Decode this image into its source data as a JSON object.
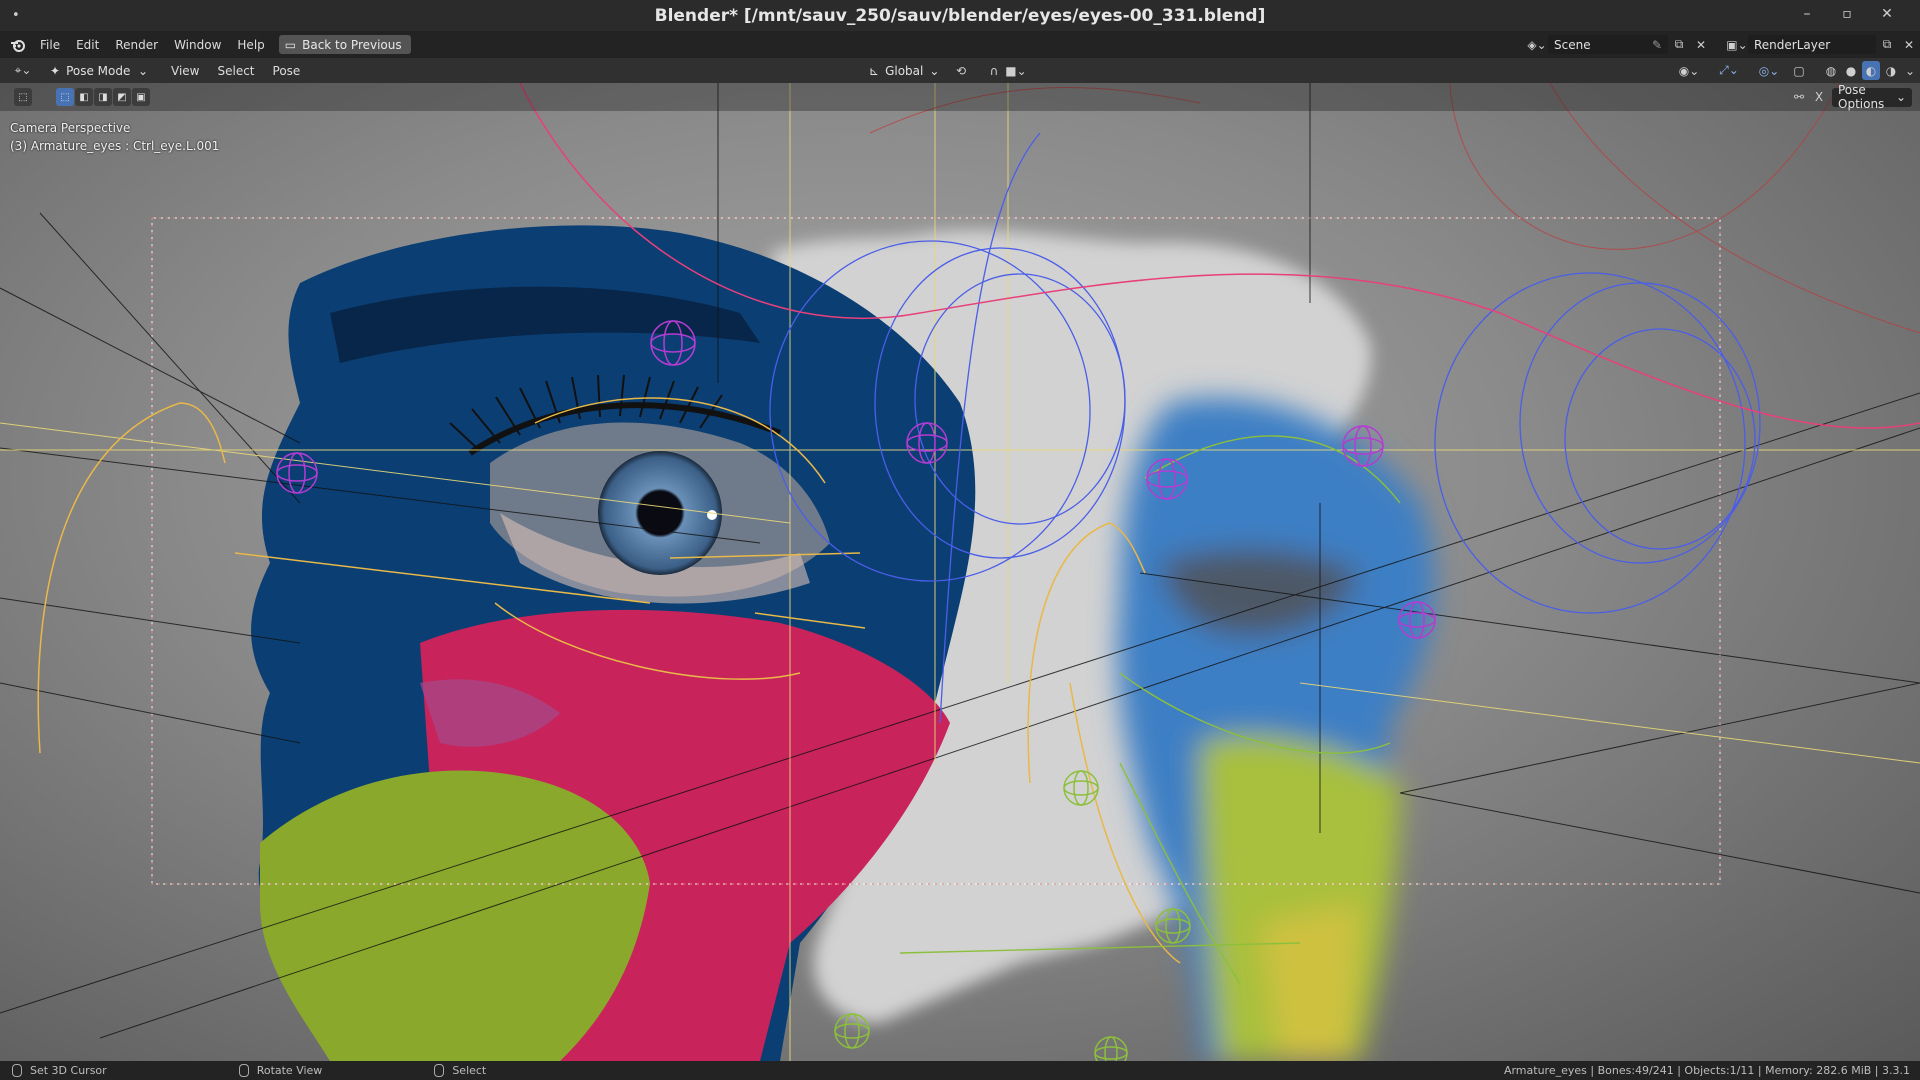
{
  "window": {
    "title": "Blender* [/mnt/sauv_250/sauv/blender/eyes/eyes-00_331.blend]",
    "controls": [
      "–",
      "▫",
      "✕"
    ]
  },
  "menubar": {
    "items": [
      "File",
      "Edit",
      "Render",
      "Window",
      "Help"
    ],
    "back_button": "Back to Previous",
    "scene": "Scene",
    "render_layer": "RenderLayer"
  },
  "header": {
    "mode": "Pose Mode",
    "menus": [
      "View",
      "Select",
      "Pose"
    ],
    "transform_orientation": "Global",
    "pose_options": "Pose Options",
    "x_label": "X"
  },
  "viewport": {
    "perspective_label": "Camera Perspective",
    "active_object": "(3) Armature_eyes : Ctrl_eye.L.001"
  },
  "statusbar": {
    "hints": [
      "Set 3D Cursor",
      "Rotate View",
      "Select"
    ],
    "stats": "Armature_eyes | Bones:49/241 | Objects:1/11 | Memory: 282.6 MiB | 3.3.1"
  },
  "colors": {
    "accent": "#4772b3",
    "bone_blue": "#4a5ee8",
    "bone_magenta": "#b43cd2",
    "bone_yellow": "#e8c050",
    "bone_green": "#8cbf3c",
    "paint_navy": "#0b3f74",
    "paint_pink": "#c8235a",
    "paint_green": "#8aa82c"
  }
}
